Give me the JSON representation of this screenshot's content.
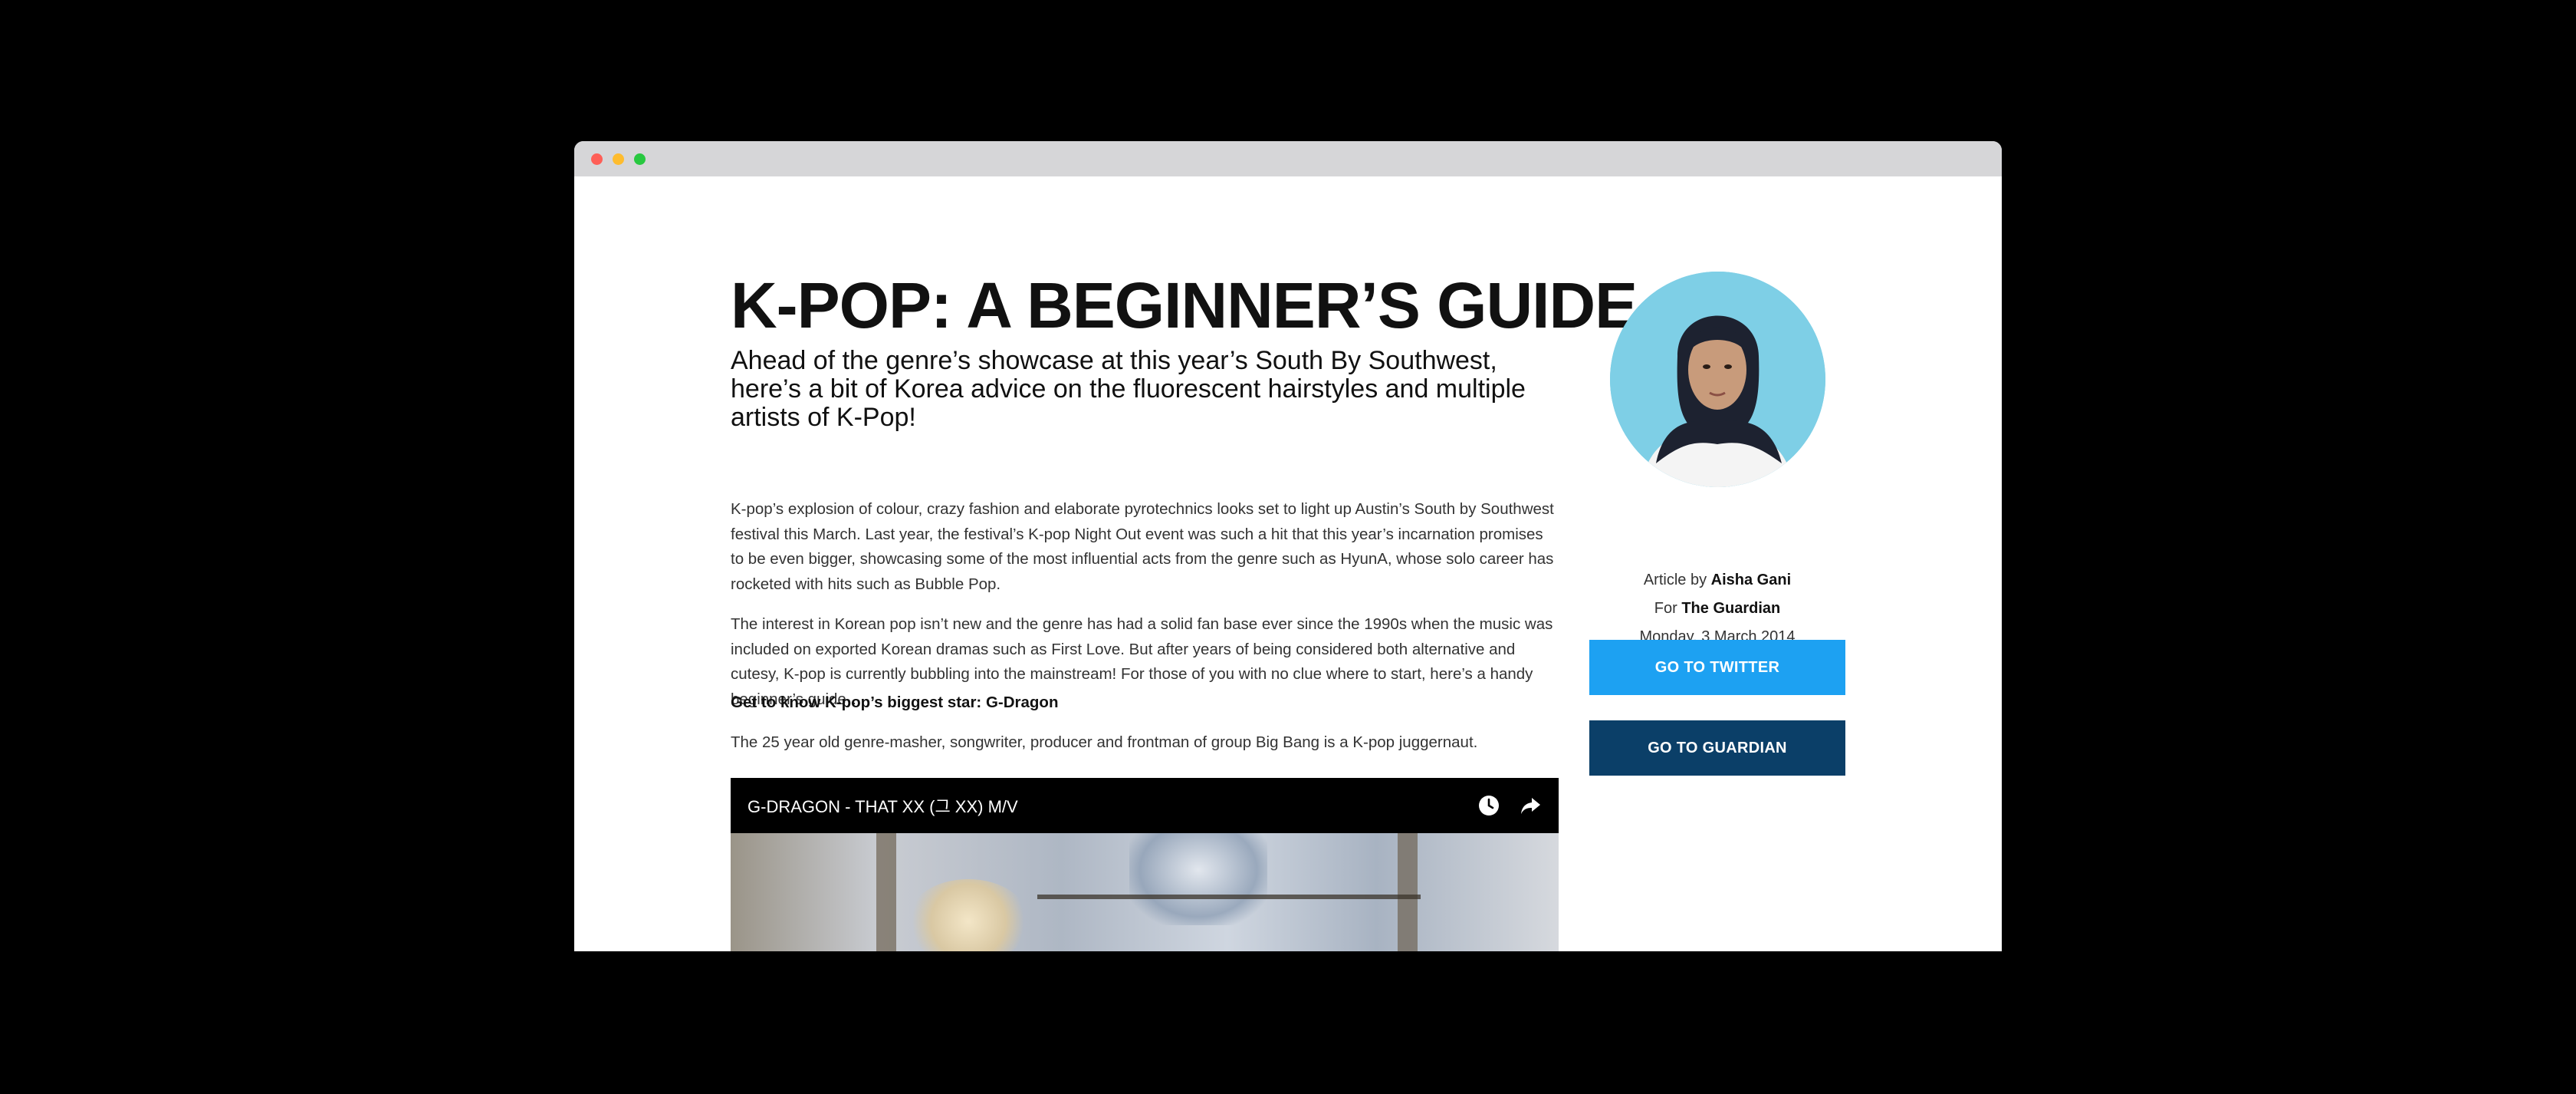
{
  "article": {
    "title": "K-POP: A BEGINNER’S GUIDE",
    "subtitle": "Ahead of the genre’s showcase at this year’s South By Southwest, here’s a bit of Korea advice on the fluorescent hairstyles and multiple artists of K-Pop!",
    "paragraphs": [
      "K-pop’s explosion of colour, crazy fashion and elaborate pyrotechnics looks set to light up Austin’s South by Southwest festival this March. Last year, the festival’s K-pop Night Out event was such a hit that this year’s incarnation promises to be even bigger, showcasing some of the most influential acts from the genre such as HyunA, whose solo career has rocketed with hits such as Bubble Pop.",
      "The interest in Korean pop isn’t new and the genre has had a solid fan base ever since the 1990s when the music was included on exported Korean dramas such as First Love. But after years of being considered both alternative and cutesy, K-pop is currently bubbling into the mainstream! For those of you with no clue where to start, here’s a handy beginner’s guide…",
      "Get to know K-pop’s biggest star: G-Dragon",
      "The 25 year old genre-masher, songwriter, producer and frontman of group Big Bang is a K-pop juggernaut."
    ]
  },
  "video": {
    "title": "G-DRAGON - THAT XX (그 XX) M/V",
    "icons": [
      "clock-icon",
      "share-icon"
    ]
  },
  "sidebar": {
    "article_by_label": "Article by",
    "author": "Aisha Gani",
    "for_label": "For",
    "publication": "The Guardian",
    "date": "Monday, 3 March 2014",
    "twitter_button": "GO TO TWITTER",
    "guardian_button": "GO TO GUARDIAN"
  },
  "colors": {
    "twitter": "#1da1f2",
    "guardian": "#0b3f68",
    "avatar_bg": "#7ecfe6"
  }
}
